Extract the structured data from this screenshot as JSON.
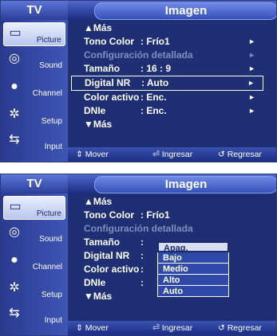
{
  "screen1": {
    "tv_label": "TV",
    "title": "Imagen",
    "sidebar": [
      {
        "label": "Picture",
        "icon": "picture-icon",
        "active": true
      },
      {
        "label": "Sound",
        "icon": "sound-icon",
        "active": false
      },
      {
        "label": "Channel",
        "icon": "channel-icon",
        "active": false
      },
      {
        "label": "Setup",
        "icon": "setup-icon",
        "active": false
      },
      {
        "label": "Input",
        "icon": "input-icon",
        "active": false
      }
    ],
    "menu": [
      {
        "key": "▲Más",
        "value": "",
        "arrow": ""
      },
      {
        "key": "Tono Color",
        "value": ": Frío1",
        "arrow": "►"
      },
      {
        "key": "Configuración detallada",
        "value": "",
        "arrow": "►"
      },
      {
        "key": "Tamaño",
        "value": ": 16 : 9",
        "arrow": "►"
      },
      {
        "key": "Digital NR",
        "value": ": Auto",
        "arrow": "►"
      },
      {
        "key": "Color activo",
        "value": ": Enc.",
        "arrow": "►"
      },
      {
        "key": "DNIe",
        "value": ": Enc.",
        "arrow": "►"
      },
      {
        "key": "▼Más",
        "value": "",
        "arrow": ""
      }
    ],
    "footer": {
      "move": "⇕ Mover",
      "enter": "⏎ Ingresar",
      "back": "↺ Regresar"
    }
  },
  "screen2": {
    "tv_label": "TV",
    "title": "Imagen",
    "sidebar": [
      {
        "label": "Picture",
        "icon": "picture-icon",
        "active": true
      },
      {
        "label": "Sound",
        "icon": "sound-icon",
        "active": false
      },
      {
        "label": "Channel",
        "icon": "channel-icon",
        "active": false
      },
      {
        "label": "Setup",
        "icon": "setup-icon",
        "active": false
      },
      {
        "label": "Input",
        "icon": "input-icon",
        "active": false
      }
    ],
    "menu": [
      {
        "key": "▲Más",
        "value": ""
      },
      {
        "key": "Tono Color",
        "value": ": Frío1"
      },
      {
        "key": "Configuración detallada",
        "value": ""
      },
      {
        "key": "Tamaño",
        "value": ":"
      },
      {
        "key": "Digital NR",
        "value": ":"
      },
      {
        "key": "Color activo",
        "value": ":"
      },
      {
        "key": "DNIe",
        "value": ":"
      },
      {
        "key": "▼Más",
        "value": ""
      }
    ],
    "dropdown": [
      "Apag.",
      "Bajo",
      "Medio",
      "Alto",
      "Auto"
    ],
    "footer": {
      "move": "⇕ Mover",
      "enter": "⏎ Ingresar",
      "back": "↺ Regresar"
    }
  }
}
